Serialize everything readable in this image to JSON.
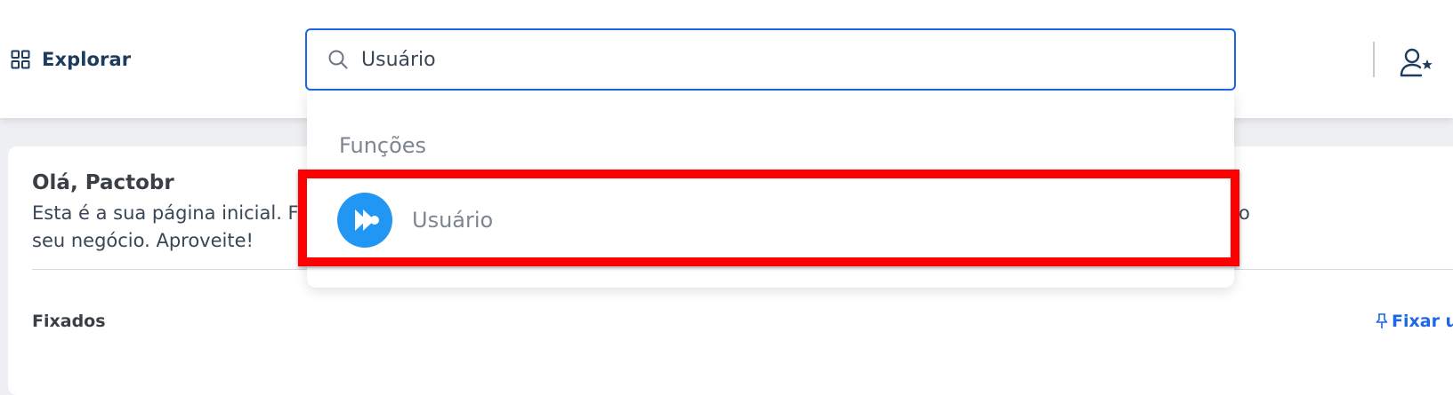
{
  "header": {
    "explore_label": "Explorar",
    "search_value": "Usuário"
  },
  "dropdown": {
    "section_label": "Funções",
    "results": [
      {
        "label": "Usuário",
        "icon": "fast-forward-circle-icon"
      }
    ]
  },
  "main": {
    "greeting_title": "Olá, Pactobr",
    "greeting_text": "Esta é a sua página inicial. F                                                                                                                                                              o seu negócio. Aproveite!",
    "greeting_line1": "Esta é a sua página inicial. F",
    "greeting_line1_tail": "o",
    "greeting_line2": "seu negócio. Aproveite!",
    "pinned_title": "Fixados",
    "pin_link_label": "Fixar u"
  },
  "colors": {
    "accent": "#1e66e6",
    "highlight": "#ff0000",
    "result_icon_bg": "#2196f3",
    "text_dark": "#1d3b5e"
  }
}
